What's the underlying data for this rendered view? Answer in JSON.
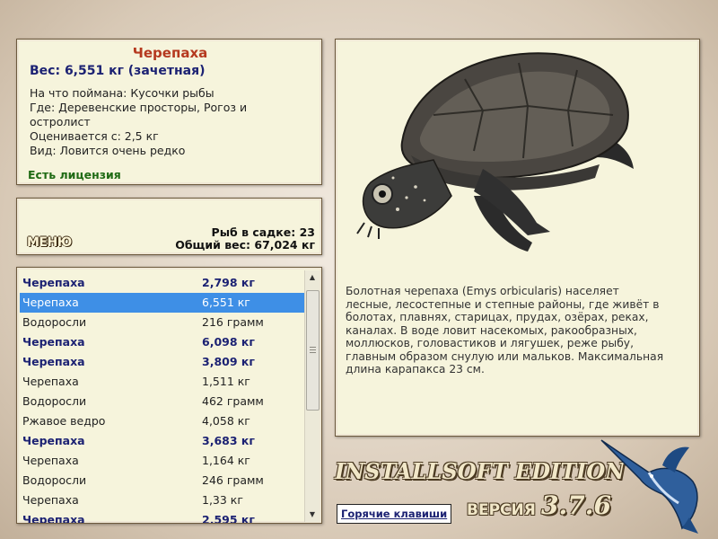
{
  "info": {
    "title": "Черепаха",
    "weight": "Вес: 6,551 кг (зачетная)",
    "lines": [
      "На что поймана: Кусочки рыбы",
      "Где: Деревенские просторы, Рогоз и",
      "остролист",
      "Оценивается с: 2,5 кг",
      "Вид: Ловится очень редко"
    ],
    "license": "Есть лицензия"
  },
  "menu": {
    "button_label": "МЕНЮ",
    "fish_count": "Рыб в садке: 23",
    "total_weight": "Общий вес: 67,024 кг"
  },
  "catch_list": [
    {
      "name": "Черепаха",
      "weight": "2,798 кг",
      "bold": true,
      "selected": false
    },
    {
      "name": "Черепаха",
      "weight": "6,551 кг",
      "bold": false,
      "selected": true
    },
    {
      "name": "Водоросли",
      "weight": "216 грамм",
      "bold": false,
      "selected": false
    },
    {
      "name": "Черепаха",
      "weight": "6,098 кг",
      "bold": true,
      "selected": false
    },
    {
      "name": "Черепаха",
      "weight": "3,809 кг",
      "bold": true,
      "selected": false
    },
    {
      "name": "Черепаха",
      "weight": "1,511 кг",
      "bold": false,
      "selected": false
    },
    {
      "name": "Водоросли",
      "weight": "462 грамм",
      "bold": false,
      "selected": false
    },
    {
      "name": "Ржавое ведро",
      "weight": "4,058 кг",
      "bold": false,
      "selected": false
    },
    {
      "name": "Черепаха",
      "weight": "3,683 кг",
      "bold": true,
      "selected": false
    },
    {
      "name": "Черепаха",
      "weight": "1,164 кг",
      "bold": false,
      "selected": false
    },
    {
      "name": "Водоросли",
      "weight": "246 грамм",
      "bold": false,
      "selected": false
    },
    {
      "name": "Черепаха",
      "weight": "1,33 кг",
      "bold": false,
      "selected": false
    },
    {
      "name": "Черепаха",
      "weight": "2,595 кг",
      "bold": true,
      "selected": false
    }
  ],
  "description": "Болотная черепаха (Emys orbicularis) населяет лесные, лесостепные и степные районы, где живёт в болотах, плавнях, старицах, прудах, озёрах, реках, каналах. В воде ловит насекомых, ракообразных, моллюсков, головастиков и лягушек, реже рыбу, главным образом снулую или мальков. Максимальная длина карапакса 23 см.",
  "footer": {
    "brand": "INSTALLSOFT EDITION",
    "hotkeys": "Горячие клавиши",
    "version_label": "ВЕРСИЯ",
    "version_number": "3.7.6"
  },
  "colors": {
    "title_red": "#b5391f",
    "weight_blue": "#1c2273",
    "license_green": "#1f6a14",
    "selection": "#3e8fe6",
    "panel_bg": "#f6f4dc"
  },
  "icons": {
    "image": "turtle-illustration",
    "logo": "marlin-fish-icon"
  }
}
